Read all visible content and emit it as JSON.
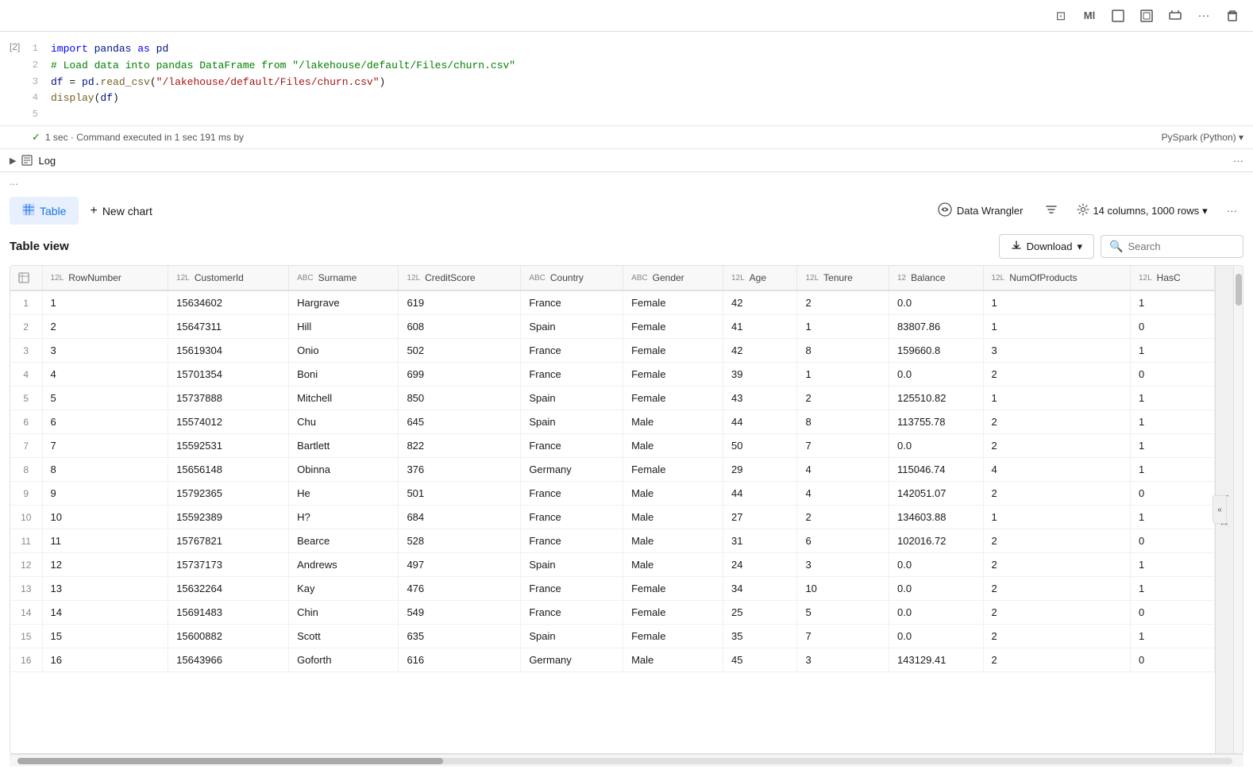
{
  "toolbar": {
    "icons": [
      "⊡",
      "Ml",
      "⬜",
      "⬜",
      "⬜",
      "···"
    ]
  },
  "cell": {
    "number": "[2]",
    "lines": [
      {
        "num": "1",
        "content": "import pandas as pd"
      },
      {
        "num": "2",
        "content": "# Load data into pandas DataFrame from \"/lakehouse/default/Files/churn.csv\""
      },
      {
        "num": "3",
        "content": "df = pd.read_csv(\"/lakehouse/default/Files/churn.csv\")"
      },
      {
        "num": "4",
        "content": "display(df)"
      },
      {
        "num": "5",
        "content": ""
      }
    ],
    "exec_status": "1 sec · Command executed in 1 sec 191 ms by",
    "runtime": "PySpark (Python)"
  },
  "log": {
    "label": "Log"
  },
  "ellipsis": "...",
  "tabs": {
    "table_label": "Table",
    "new_chart_label": "+ New chart",
    "data_wrangler_label": "Data Wrangler",
    "col_info": "14 columns, 1000 rows",
    "more": "···"
  },
  "table_view": {
    "title": "Table view",
    "download_label": "Download",
    "search_placeholder": "Search",
    "columns": [
      {
        "type": "12L",
        "name": "RowNumber"
      },
      {
        "type": "12L",
        "name": "CustomerId"
      },
      {
        "type": "ABC",
        "name": "Surname"
      },
      {
        "type": "12L",
        "name": "CreditScore"
      },
      {
        "type": "ABC",
        "name": "Country"
      },
      {
        "type": "ABC",
        "name": "Gender"
      },
      {
        "type": "12L",
        "name": "Age"
      },
      {
        "type": "12L",
        "name": "Tenure"
      },
      {
        "type": "12",
        "name": "Balance"
      },
      {
        "type": "12L",
        "name": "NumOfProducts"
      },
      {
        "type": "12L",
        "name": "HasC"
      }
    ],
    "rows": [
      [
        1,
        1,
        15634602,
        "Hargrave",
        619,
        "France",
        "Female",
        42,
        2,
        "0.0",
        1,
        1
      ],
      [
        2,
        2,
        15647311,
        "Hill",
        608,
        "Spain",
        "Female",
        41,
        1,
        "83807.86",
        1,
        0
      ],
      [
        3,
        3,
        15619304,
        "Onio",
        502,
        "France",
        "Female",
        42,
        8,
        "159660.8",
        3,
        1
      ],
      [
        4,
        4,
        15701354,
        "Boni",
        699,
        "France",
        "Female",
        39,
        1,
        "0.0",
        2,
        0
      ],
      [
        5,
        5,
        15737888,
        "Mitchell",
        850,
        "Spain",
        "Female",
        43,
        2,
        "125510.82",
        1,
        1
      ],
      [
        6,
        6,
        15574012,
        "Chu",
        645,
        "Spain",
        "Male",
        44,
        8,
        "113755.78",
        2,
        1
      ],
      [
        7,
        7,
        15592531,
        "Bartlett",
        822,
        "France",
        "Male",
        50,
        7,
        "0.0",
        2,
        1
      ],
      [
        8,
        8,
        15656148,
        "Obinna",
        376,
        "Germany",
        "Female",
        29,
        4,
        "115046.74",
        4,
        1
      ],
      [
        9,
        9,
        15792365,
        "He",
        501,
        "France",
        "Male",
        44,
        4,
        "142051.07",
        2,
        0
      ],
      [
        10,
        10,
        15592389,
        "H?",
        684,
        "France",
        "Male",
        27,
        2,
        "134603.88",
        1,
        1
      ],
      [
        11,
        11,
        15767821,
        "Bearce",
        528,
        "France",
        "Male",
        31,
        6,
        "102016.72",
        2,
        0
      ],
      [
        12,
        12,
        15737173,
        "Andrews",
        497,
        "Spain",
        "Male",
        24,
        3,
        "0.0",
        2,
        1
      ],
      [
        13,
        13,
        15632264,
        "Kay",
        476,
        "France",
        "Female",
        34,
        10,
        "0.0",
        2,
        1
      ],
      [
        14,
        14,
        15691483,
        "Chin",
        549,
        "France",
        "Female",
        25,
        5,
        "0.0",
        2,
        0
      ],
      [
        15,
        15,
        15600882,
        "Scott",
        635,
        "Spain",
        "Female",
        35,
        7,
        "0.0",
        2,
        1
      ],
      [
        16,
        16,
        15643966,
        "Goforth",
        616,
        "Germany",
        "Male",
        45,
        3,
        "143129.41",
        2,
        0
      ]
    ]
  },
  "inspect_label": "Inspect"
}
